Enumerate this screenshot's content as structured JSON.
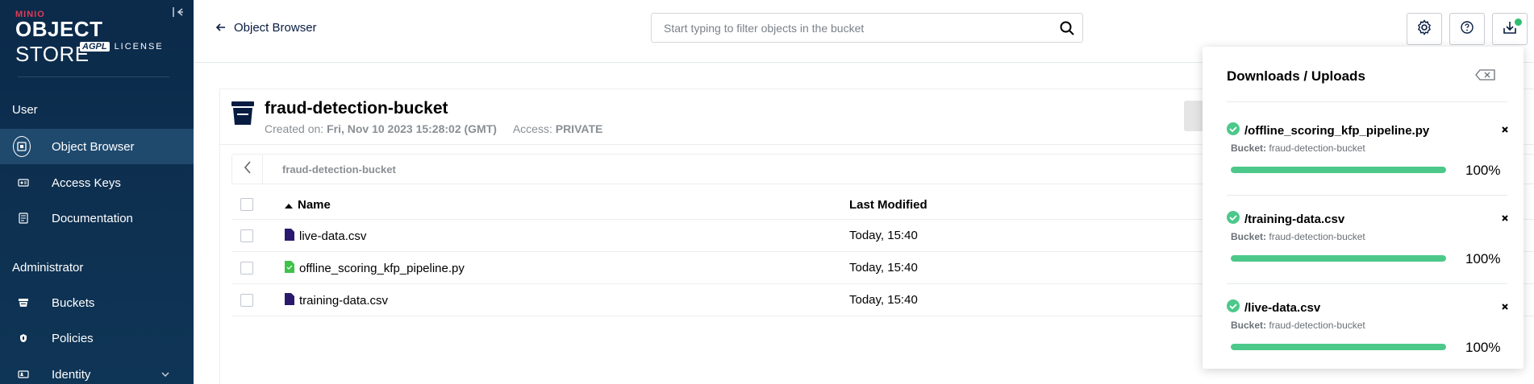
{
  "sidebar": {
    "brand": "MINIO",
    "product_bold": "OBJECT",
    "product_rest": " STORE",
    "license_badge": "AGPL",
    "license_label": "LICENSE",
    "sections": {
      "user": "User",
      "admin": "Administrator"
    },
    "items": [
      {
        "label": "Object Browser",
        "icon": "object-browser-icon",
        "active": true
      },
      {
        "label": "Access Keys",
        "icon": "access-keys-icon"
      },
      {
        "label": "Documentation",
        "icon": "documentation-icon"
      },
      {
        "label": "Buckets",
        "icon": "buckets-icon"
      },
      {
        "label": "Policies",
        "icon": "policies-icon"
      },
      {
        "label": "Identity",
        "icon": "identity-icon"
      }
    ]
  },
  "topbar": {
    "back_label": "Object Browser",
    "search_placeholder": "Start typing to filter objects in the bucket"
  },
  "bucket": {
    "name": "fraud-detection-bucket",
    "created_label": "Created on:",
    "created_value": "Fri, Nov 10 2023 15:28:02 (GMT)",
    "access_label": "Access:",
    "access_value": "PRIVATE",
    "breadcrumb": "fraud-detection-bucket"
  },
  "table": {
    "columns": {
      "name": "Name",
      "modified": "Last Modified"
    },
    "rows": [
      {
        "name": "live-data.csv",
        "modified": "Today, 15:40",
        "icon": "file-icon"
      },
      {
        "name": "offline_scoring_kfp_pipeline.py",
        "modified": "Today, 15:40",
        "icon": "python-file-icon"
      },
      {
        "name": "training-data.csv",
        "modified": "Today, 15:40",
        "icon": "file-icon"
      }
    ]
  },
  "downloads": {
    "title": "Downloads / Uploads",
    "bucket_label": "Bucket:",
    "items": [
      {
        "name": "/offline_scoring_kfp_pipeline.py",
        "bucket": "fraud-detection-bucket",
        "progress": 100,
        "progress_label": "100%"
      },
      {
        "name": "/training-data.csv",
        "bucket": "fraud-detection-bucket",
        "progress": 100,
        "progress_label": "100%"
      },
      {
        "name": "/live-data.csv",
        "bucket": "fraud-detection-bucket",
        "progress": 100,
        "progress_label": "100%"
      }
    ]
  },
  "colors": {
    "sidebar_bg": "#0c2a4a",
    "active_item": "#1f4a6e",
    "brand_red": "#e03b55",
    "success_green": "#4cc88a"
  }
}
